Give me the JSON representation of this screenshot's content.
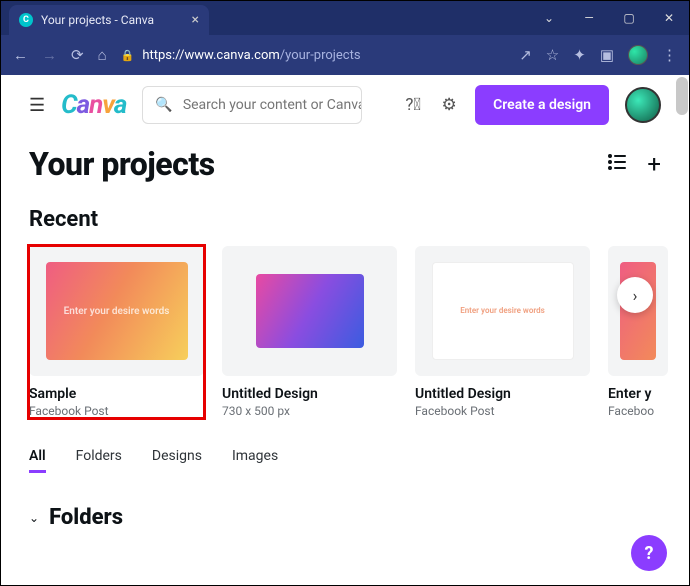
{
  "browser": {
    "tab_title": "Your projects - Canva",
    "url_domain": "https://www.canva.com",
    "url_path": "/your-projects"
  },
  "header": {
    "search_placeholder": "Search your content or Canva's",
    "create_label": "Create a design"
  },
  "page": {
    "title": "Your projects",
    "recent_label": "Recent",
    "folders_label": "Folders"
  },
  "cards": [
    {
      "title": "Sample",
      "subtitle": "Facebook Post",
      "thumb_text": "Enter your desire words"
    },
    {
      "title": "Untitled Design",
      "subtitle": "730 x 500 px",
      "thumb_text": ""
    },
    {
      "title": "Untitled Design",
      "subtitle": "Facebook Post",
      "thumb_text": "Enter your desire words"
    },
    {
      "title": "Enter y",
      "subtitle": "Faceboo",
      "thumb_text": ""
    }
  ],
  "tabs": {
    "all": "All",
    "folders": "Folders",
    "designs": "Designs",
    "images": "Images"
  },
  "help": "?"
}
